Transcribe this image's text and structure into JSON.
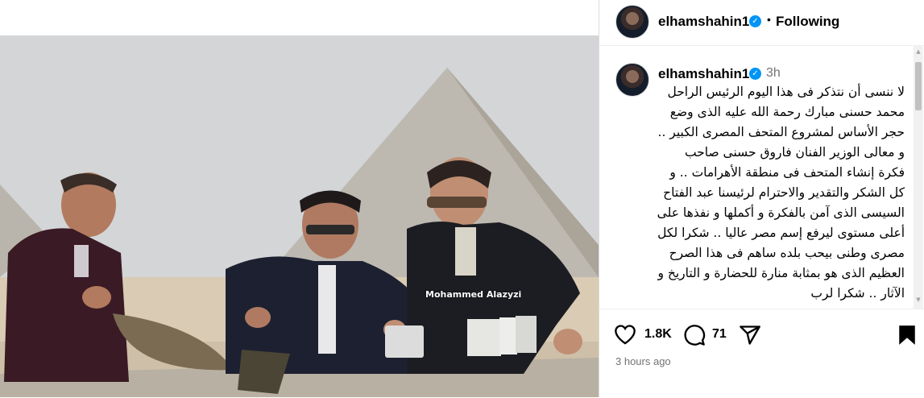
{
  "post": {
    "username": "elhamshahin1",
    "follow_status": "Following",
    "caption_time": "3h",
    "caption": "لا ننسى أن نتذكر فى هذا اليوم الرئيس الراحل محمد حسنى مبارك رحمة الله عليه الذى وضع حجر الأساس لمشروع المتحف المصرى الكبير .. و معالى الوزير الفنان فاروق حسنى  صاحب فكرة إنشاء المتحف فى منطقة الأهرامات .. و كل الشكر والتقدير والاحترام لرئيسنا عبد الفتاح السيسى الذى آمن بالفكرة و أكملها و نفذها على أعلى مستوى ليرفع إسم مصر عاليا .. شكرا لكل مصرى وطنى بيحب بلده ساهم فى هذا الصرح العظيم الذى هو بمثابة منارة للحضارة  و التاريخ و الآثار .. شكرا لرب",
    "likes": "1.8K",
    "comments": "71",
    "date": "3 hours ago"
  },
  "media": {
    "watermark": "Mohammed Alazyzi"
  },
  "icons": {
    "like": "heart-icon",
    "comment": "comment-bubble-icon",
    "share": "paper-plane-icon",
    "save": "bookmark-icon",
    "verified": "verified-badge-icon"
  },
  "colors": {
    "verified": "#0095f6",
    "secondary_text": "#737373"
  }
}
